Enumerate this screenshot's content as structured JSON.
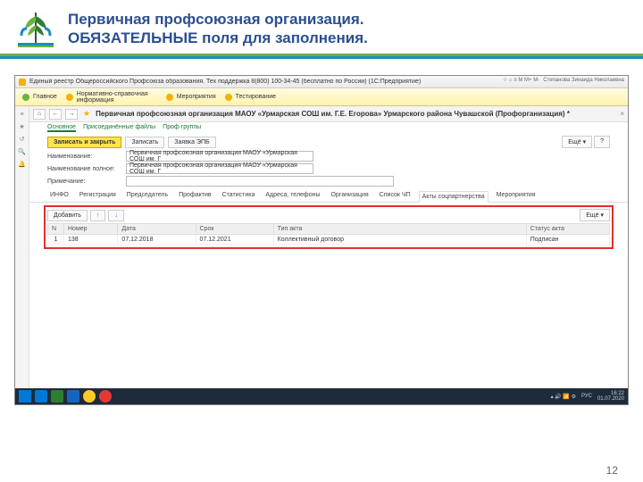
{
  "slide": {
    "title_line1": "Первичная профсоюзная организация.",
    "title_line2": "ОБЯЗАТЕЛЬНЫЕ поля для заполнения.",
    "page_number": "12"
  },
  "window": {
    "title": "Единый реестр Общероссийского Профсоюза образования. Тех поддержка 8(800) 100-34-45 (бесплатно по России) (1С:Предприятие)",
    "user": "Степанова Зинаида Николаевна",
    "corner_icons": "☆ ⌂ ≡  M M+ M-"
  },
  "mainmenu": {
    "items": [
      "Главное",
      "Нормативно-справочная информация",
      "Мероприятия",
      "Тестирование"
    ]
  },
  "nav": {
    "back": "←",
    "fwd": "→",
    "star": "★"
  },
  "form": {
    "title": "Первичная профсоюзная организация МАОУ «Урмарская СОШ им. Г.Е. Егорова» Урмарского района Чувашской (Профорганизация) *",
    "subtabs": [
      "Основное",
      "Присоединённые файлы",
      "Проф группы"
    ],
    "save_close": "Записать и закрыть",
    "save": "Записать",
    "sign_label": "Заявка ЭПБ",
    "more": "Ещё",
    "help": "?",
    "fields": {
      "name_label": "Наименование:",
      "name_value": "Первичная профсоюзная организация МАОУ «Урмарская СОШ им. Г",
      "fullname_label": "Наименование полное:",
      "fullname_value": "Первичная профсоюзная организация МАОУ «Урмарская СОШ им. Г",
      "note_label": "Примечание:",
      "note_value": ""
    },
    "inner_tabs": [
      "ИНФО",
      "Регистрация",
      "Председатель",
      "Профактив",
      "Статистика",
      "Адреса, телефоны",
      "Организация",
      "Список ЧП",
      "Акты соцпартнерства",
      "Мероприятия"
    ],
    "inner_selected": 8
  },
  "grid": {
    "add": "Добавить",
    "up": "↑",
    "down": "↓",
    "more": "Ещё",
    "columns": [
      "N",
      "Номер",
      "Дата",
      "Срок",
      "Тип акта",
      "Статус акта"
    ],
    "rows": [
      {
        "n": "1",
        "num": "138",
        "date": "07.12.2018",
        "term": "07.12.2021",
        "type": "Коллективный договор",
        "status": "Подписан"
      }
    ]
  },
  "taskbar": {
    "time": "16:22",
    "date": "01.07.2020",
    "lang": "РУС"
  }
}
